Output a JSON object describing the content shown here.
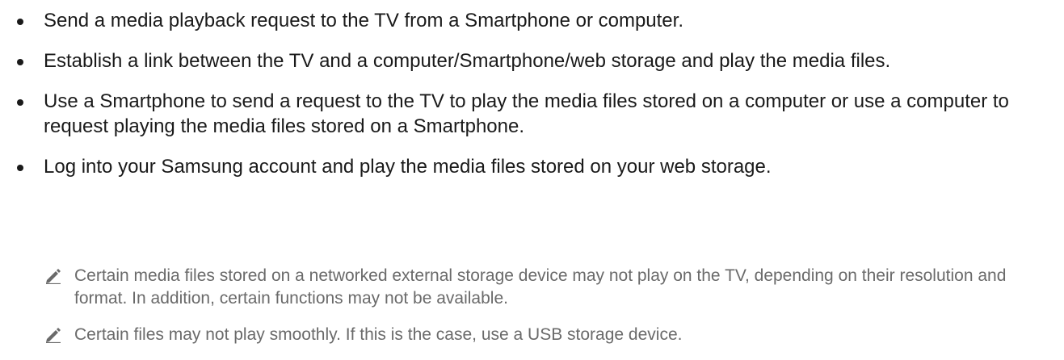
{
  "bullets": [
    {
      "text": "Send a media playback request to the TV from a Smartphone or computer."
    },
    {
      "text": "Establish a link between the TV and a computer/Smartphone/web storage and play the media files."
    },
    {
      "text": "Use a Smartphone to send a request to the TV to play the media files stored on a computer or use a computer to request playing the media files stored on a Smartphone."
    },
    {
      "text": "Log into your Samsung account and play the media files stored on your web storage."
    }
  ],
  "notes": [
    {
      "icon": "pencil-icon",
      "text": "Certain media files stored on a networked external storage device may not play on the TV, depending on their resolution and format. In addition, certain functions may not be available."
    },
    {
      "icon": "pencil-icon",
      "text": "Certain files may not play smoothly. If this is the case, use a USB storage device."
    }
  ],
  "colors": {
    "body_text": "#1a1a1a",
    "note_text": "#6a6a6a",
    "icon": "#6a6a6a"
  }
}
